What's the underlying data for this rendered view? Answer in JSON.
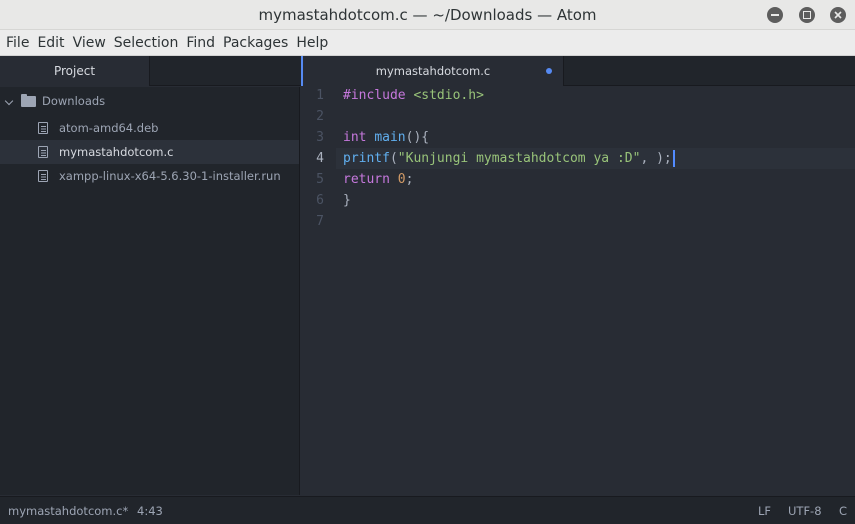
{
  "window": {
    "title": "mymastahdotcom.c — ~/Downloads — Atom"
  },
  "menu": [
    "File",
    "Edit",
    "View",
    "Selection",
    "Find",
    "Packages",
    "Help"
  ],
  "tabs": {
    "project": "Project",
    "file": "mymastahdotcom.c"
  },
  "tree": {
    "folder": "Downloads",
    "files": [
      "atom-amd64.deb",
      "mymastahdotcom.c",
      "xampp-linux-x64-5.6.30-1-installer.run"
    ],
    "selected_index": 1
  },
  "editor": {
    "line_numbers": [
      "1",
      "2",
      "3",
      "4",
      "5",
      "6",
      "7"
    ],
    "current_line": 4,
    "code": {
      "l1_directive": "#include",
      "l1_header": " <stdio.h>",
      "l3_type": "int",
      "l3_name": "main",
      "l3_rest": "(){",
      "l4_call": "printf",
      "l4_open": "(",
      "l4_string": "\"Kunjungi mymastahdotcom ya :D\"",
      "l4_rest": ", );",
      "l5_keyword": "return",
      "l5_value": "0",
      "l5_end": ";",
      "l6": "}"
    }
  },
  "status": {
    "file": "mymastahdotcom.c*",
    "cursor": "4:43",
    "line_ending": "LF",
    "encoding": "UTF-8",
    "grammar": "C"
  },
  "colors": {
    "accent": "#568af2",
    "editor_bg": "#282c34",
    "panel_bg": "#21252b"
  }
}
